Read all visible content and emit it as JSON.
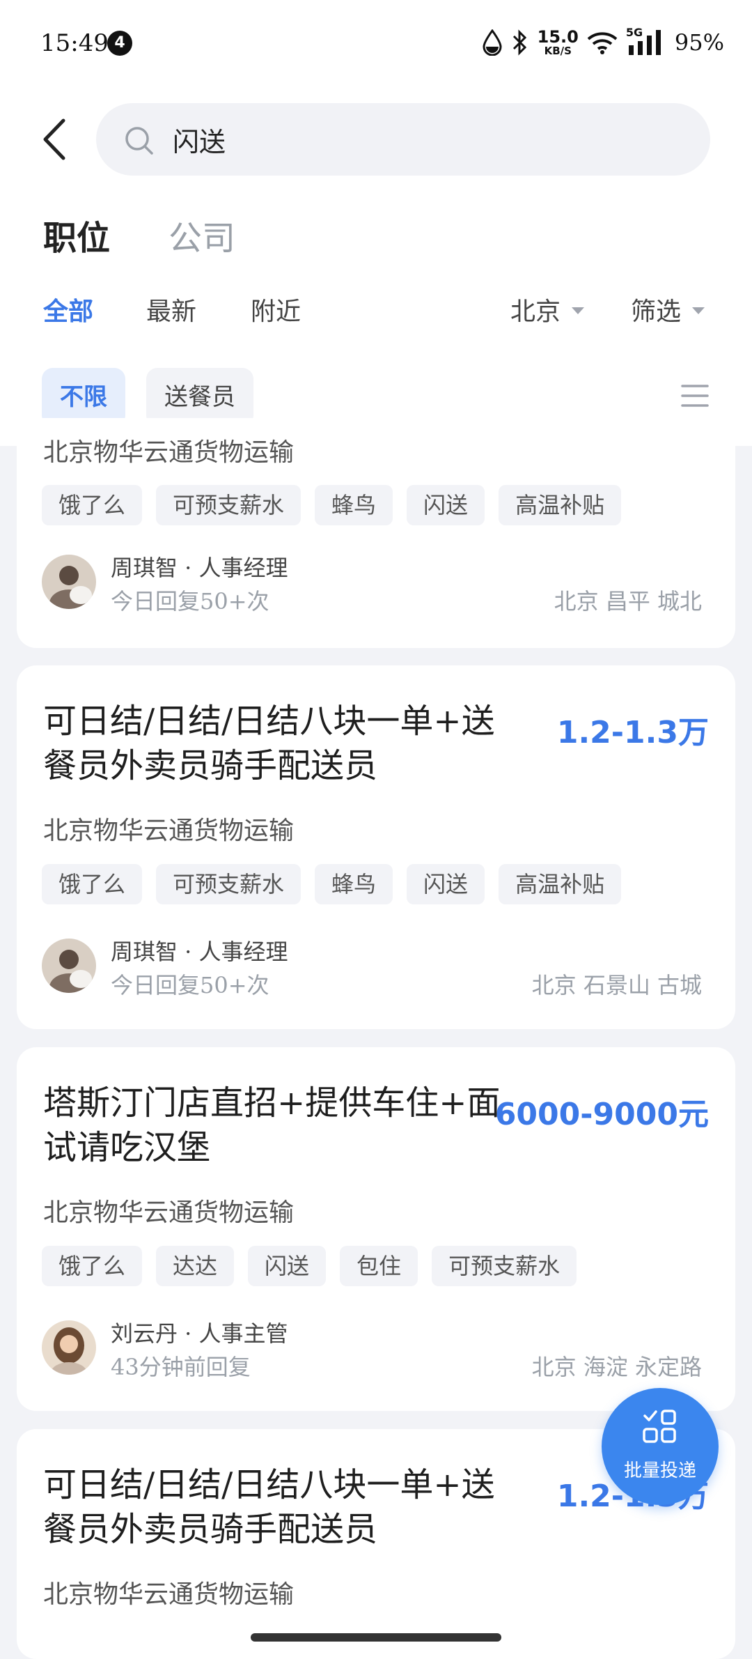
{
  "status": {
    "time": "15:49",
    "notifications": "4",
    "speed_value": "15.0",
    "speed_unit": "KB/S",
    "network": "5G",
    "battery": "95%"
  },
  "search": {
    "query": "闪送"
  },
  "main_tabs": [
    "职位",
    "公司"
  ],
  "sub_tabs": [
    "全部",
    "最新",
    "附近"
  ],
  "dropdowns": {
    "city": "北京",
    "filter": "筛选"
  },
  "chips": [
    "不限",
    "送餐员"
  ],
  "jobs": [
    {
      "company": "北京物华云通货物运输",
      "tags": [
        "饿了么",
        "可预支薪水",
        "蜂鸟",
        "闪送",
        "高温补贴"
      ],
      "person": "周琪智 · 人事经理",
      "reply": "今日回复50+次",
      "location": "北京 昌平 城北"
    },
    {
      "title": "可日结/日结/日结八块一单+送餐员外卖员骑手配送员",
      "salary": "1.2-1.3万",
      "company": "北京物华云通货物运输",
      "tags": [
        "饿了么",
        "可预支薪水",
        "蜂鸟",
        "闪送",
        "高温补贴"
      ],
      "person": "周琪智 · 人事经理",
      "reply": "今日回复50+次",
      "location": "北京 石景山 古城"
    },
    {
      "title": "塔斯汀门店直招+提供车住+面试请吃汉堡",
      "salary": "6000-9000元",
      "company": "北京物华云通货物运输",
      "tags": [
        "饿了么",
        "达达",
        "闪送",
        "包住",
        "可预支薪水"
      ],
      "person": "刘云丹 · 人事主管",
      "reply": "43分钟前回复",
      "location": "北京 海淀 永定路"
    },
    {
      "title": "可日结/日结/日结八块一单+送餐员外卖员骑手配送员",
      "salary": "1.2-1.3万",
      "company": "北京物华云通货物运输"
    }
  ],
  "fab": {
    "label": "批量投递"
  }
}
